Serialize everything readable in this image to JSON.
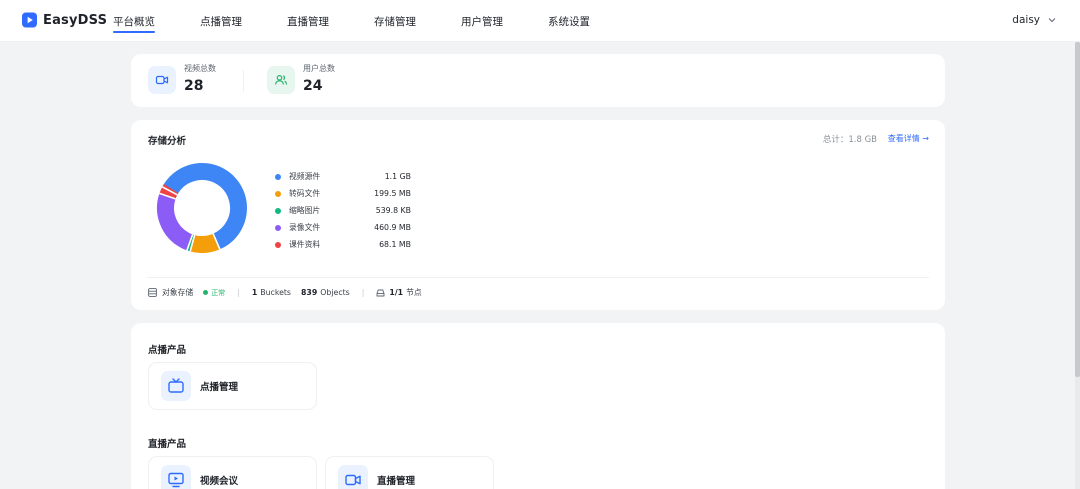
{
  "app": {
    "name": "EasyDSS"
  },
  "nav": {
    "items": [
      {
        "label": "平台概览",
        "active": true
      },
      {
        "label": "点播管理",
        "active": false
      },
      {
        "label": "直播管理",
        "active": false
      },
      {
        "label": "存储管理",
        "active": false
      },
      {
        "label": "用户管理",
        "active": false
      },
      {
        "label": "系统设置",
        "active": false
      }
    ]
  },
  "user": {
    "name": "daisy"
  },
  "stats": [
    {
      "label": "视频总数",
      "value": "28",
      "icon": "video-camera-icon",
      "color": "#2f6bff"
    },
    {
      "label": "用户总数",
      "value": "24",
      "icon": "users-icon",
      "color": "#27b26d"
    }
  ],
  "storage": {
    "title": "存储分析",
    "total": "总计：1.8 GB",
    "detail_link": "查看详情 →",
    "items": [
      {
        "name": "视频源件",
        "size": "1.1 GB",
        "color": "#3e86f5"
      },
      {
        "name": "转码文件",
        "size": "199.5 MB",
        "color": "#f59e0b"
      },
      {
        "name": "缩略图片",
        "size": "539.8 KB",
        "color": "#10b981"
      },
      {
        "name": "录像文件",
        "size": "460.9 MB",
        "color": "#8b5cf6"
      },
      {
        "name": "课件资料",
        "size": "68.1 MB",
        "color": "#ef4444"
      }
    ],
    "footer": {
      "object_storage": "对象存储",
      "status": "正常",
      "buckets_count": "1",
      "buckets_label": "Buckets",
      "objects_count": "839",
      "objects_label": "Objects",
      "nodes_count": "1/1",
      "nodes_label": "节点"
    }
  },
  "chart_data": {
    "type": "pie",
    "categories": [
      "视频源件",
      "转码文件",
      "缩略图片",
      "录像文件",
      "课件资料"
    ],
    "values": [
      1126.4,
      199.5,
      0.53,
      460.9,
      68.1
    ],
    "colors": [
      "#3e86f5",
      "#f59e0b",
      "#10b981",
      "#8b5cf6",
      "#ef4444"
    ],
    "unit": "MB"
  },
  "products": {
    "vod_title": "点播产品",
    "vod_items": [
      {
        "label": "点播管理",
        "icon": "tv-icon"
      }
    ],
    "live_title": "直播产品",
    "live_items": [
      {
        "label": "视频会议",
        "icon": "monitor-play-icon"
      },
      {
        "label": "直播管理",
        "icon": "video-camera-icon"
      }
    ]
  }
}
